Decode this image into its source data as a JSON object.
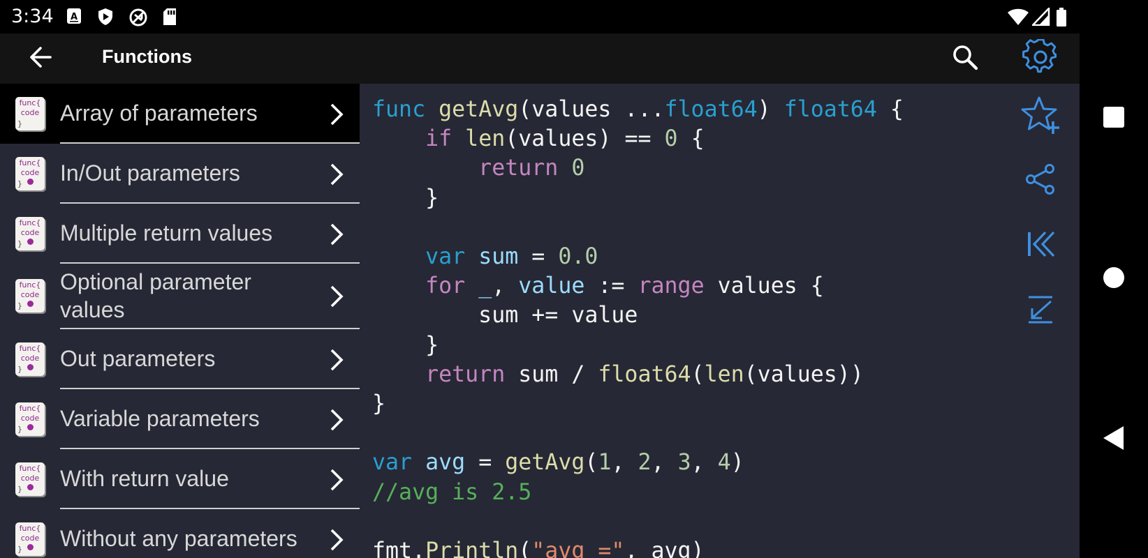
{
  "status_bar": {
    "time": "3:34",
    "left_icons": [
      "a-notification-icon",
      "play-protect-icon",
      "sync-disabled-icon",
      "sd-card-icon"
    ],
    "right_icons": [
      "wifi-icon",
      "signal-icon",
      "battery-icon"
    ]
  },
  "app_bar": {
    "title": "Functions",
    "back_icon": "arrow-back-icon",
    "search_icon": "search-icon",
    "settings_icon": "gear-icon"
  },
  "colors": {
    "background": "#262835",
    "accent": "#3f8fe0",
    "selected_item": "#000000",
    "keyword": "#c586c0",
    "type": "#2a9fd0",
    "function": "#dcdcaa",
    "number": "#b5cea8",
    "comment": "#57b05a",
    "string": "#e08a6a"
  },
  "sidebar": {
    "items": [
      {
        "label": "Array of parameters",
        "selected": true
      },
      {
        "label": "In/Out parameters",
        "selected": false
      },
      {
        "label": "Multiple return values",
        "selected": false
      },
      {
        "label": "Optional parameter values",
        "selected": false
      },
      {
        "label": "Out parameters",
        "selected": false
      },
      {
        "label": "Variable parameters",
        "selected": false
      },
      {
        "label": "With return value",
        "selected": false
      },
      {
        "label": "Without any parameters",
        "selected": false
      }
    ],
    "icon_lines": [
      "func{",
      "code",
      "}"
    ]
  },
  "code": {
    "language": "Go",
    "lines": [
      "func getAvg(values ...float64) float64 {",
      "    if len(values) == 0 {",
      "        return 0",
      "    }",
      "",
      "    var sum = 0.0",
      "    for _, value := range values {",
      "        sum += value",
      "    }",
      "    return sum / float64(len(values))",
      "}",
      "",
      "var avg = getAvg(1, 2, 3, 4)",
      "//avg is 2.5",
      "",
      "fmt.Println(\"avg =\", avg)"
    ]
  },
  "actions": [
    "star-add-icon",
    "share-icon",
    "first-page-icon",
    "scroll-to-end-icon"
  ],
  "nav_bar": [
    "recents-square-icon",
    "home-circle-icon",
    "back-triangle-icon"
  ]
}
